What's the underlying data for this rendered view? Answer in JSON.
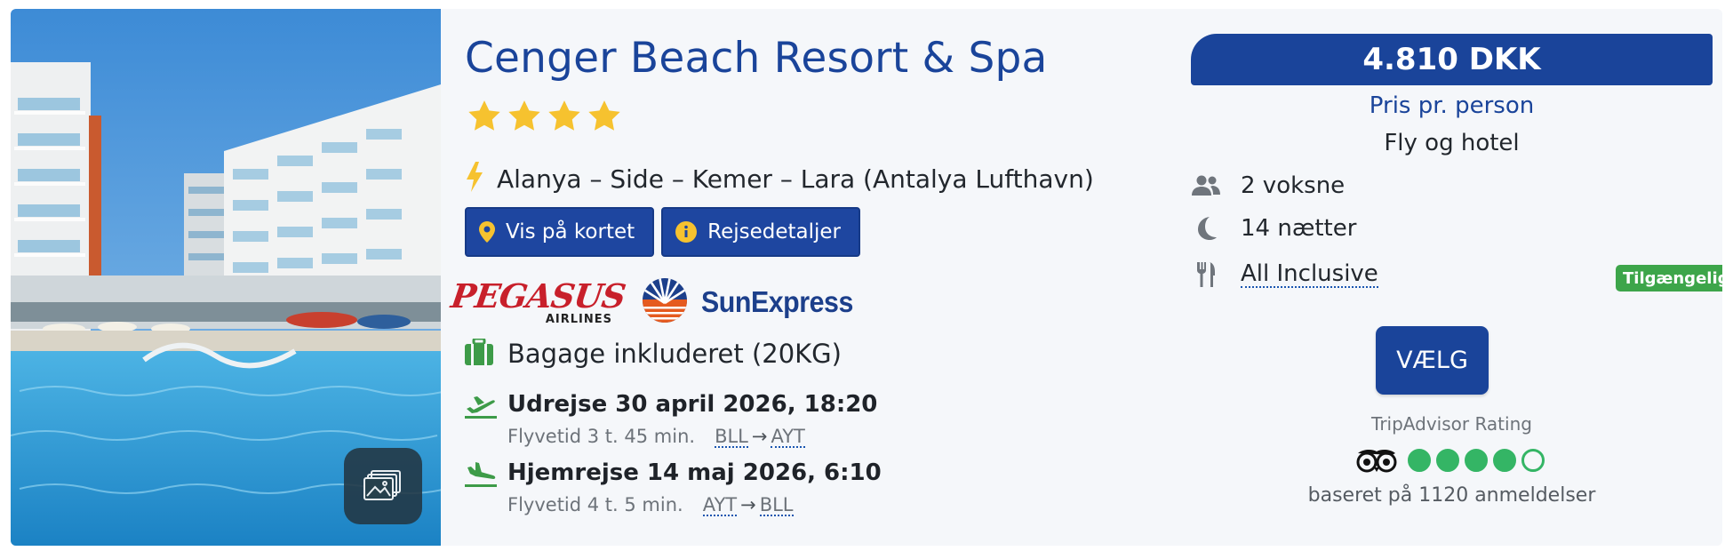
{
  "hotel": {
    "name": "Cenger Beach Resort & Spa",
    "star_rating": 4,
    "destination": "Alanya – Side – Kemer – Lara (Antalya Lufthavn)",
    "buttons": {
      "map_label": "Vis på kortet",
      "details_label": "Rejsedetaljer"
    },
    "airlines": {
      "pegasus_word": "PEGASUS",
      "pegasus_sub": "AIRLINES",
      "sunexpress_word": "SunExpress"
    },
    "baggage": "Bagage inkluderet (20KG)",
    "outbound": {
      "title": "Udrejse 30 april 2026, 18:20",
      "duration": "Flyvetid 3 t. 45 min.",
      "from": "BLL",
      "to": "AYT"
    },
    "return": {
      "title": "Hjemrejse 14 maj 2026, 6:10",
      "duration": "Flyvetid 4 t. 5 min.",
      "from": "AYT",
      "to": "BLL"
    }
  },
  "offer": {
    "price": "4.810 DKK",
    "price_label": "Pris pr. person",
    "package_type": "Fly og hotel",
    "adults": "2 voksne",
    "nights": "14 nætter",
    "board": "All Inclusive",
    "availability": "Tilgængelig",
    "select_label": "VÆLG"
  },
  "tripadvisor": {
    "label": "TripAdvisor Rating",
    "rating": 4,
    "max_rating": 5,
    "reviews": "baseret på 1120 anmeldelser"
  },
  "colors": {
    "brand_blue": "#1a449a",
    "available_green": "#3da54a",
    "tripadvisor_green": "#34b565",
    "star_yellow": "#f6c22f",
    "icon_gray": "#6f757c"
  },
  "icons": {
    "destination": "lightning-icon",
    "map": "map-pin-icon",
    "details": "info-icon",
    "baggage": "suitcase-icon",
    "outbound": "plane-takeoff-icon",
    "return": "plane-landing-icon",
    "adults": "users-icon",
    "nights": "moon-icon",
    "board": "cutlery-icon",
    "gallery": "gallery-icon"
  }
}
